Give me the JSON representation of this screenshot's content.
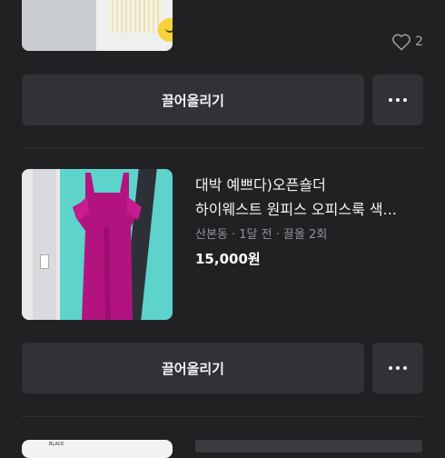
{
  "top_item": {
    "likes": "2"
  },
  "bump_button_label": "끌어올리기",
  "item": {
    "title_line1": "대박 예쁘다)오픈숄더",
    "title_line2": "하이웨스트 원피스 오피스룩 색...",
    "meta": "산본동 · 1달 전 · 끌올 2회",
    "price": "15,000원"
  },
  "bottom_item": {
    "thumb_label": "BLACK"
  },
  "colors": {
    "background": "#212124",
    "button": "#303236",
    "muted_text": "#8e9297"
  }
}
